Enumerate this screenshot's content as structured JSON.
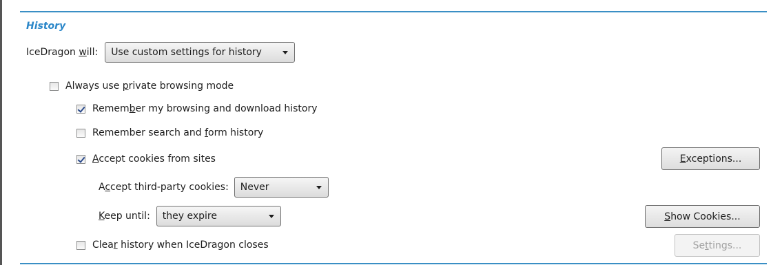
{
  "section": {
    "heading": "History"
  },
  "will": {
    "label_pre": "IceDragon ",
    "label_key": "w",
    "label_post": "ill:",
    "selected": "Use custom settings for history"
  },
  "private_mode": {
    "checked": false,
    "label_pre": "Always use ",
    "label_key": "p",
    "label_post": "rivate browsing mode"
  },
  "remember_browsing": {
    "checked": true,
    "label_pre": "Remem",
    "label_key": "b",
    "label_post": "er my browsing and download history"
  },
  "remember_search": {
    "checked": false,
    "label_pre": "Remember search and ",
    "label_key": "f",
    "label_post": "orm history"
  },
  "accept_cookies": {
    "checked": true,
    "label_pre": "",
    "label_key": "A",
    "label_post": "ccept cookies from sites"
  },
  "exceptions_button": {
    "label_pre": "",
    "label_key": "E",
    "label_post": "xceptions..."
  },
  "third_party": {
    "label_pre": "A",
    "label_key": "c",
    "label_post": "cept third-party cookies:",
    "selected": "Never"
  },
  "keep_until": {
    "label_pre": "",
    "label_key": "K",
    "label_post": "eep until:",
    "selected": "they expire"
  },
  "show_cookies_button": {
    "label_pre": "",
    "label_key": "S",
    "label_post": "how Cookies..."
  },
  "clear_history": {
    "checked": false,
    "label_pre": "Clea",
    "label_key": "r",
    "label_post": " history when IceDragon closes"
  },
  "settings_button": {
    "label_pre": "Se",
    "label_key": "t",
    "label_post": "tings...",
    "disabled": true
  }
}
